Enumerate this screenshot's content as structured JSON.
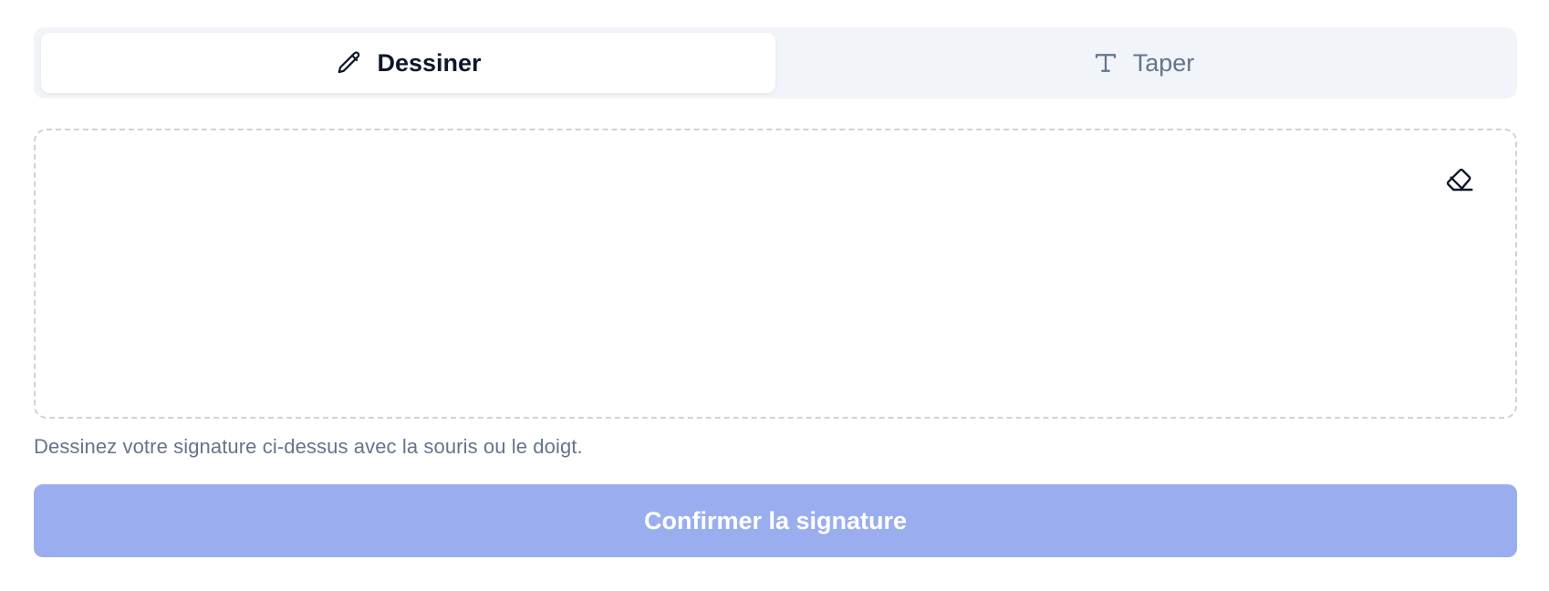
{
  "tabs": [
    {
      "label": "Dessiner",
      "icon": "pencil-icon",
      "active": true
    },
    {
      "label": "Taper",
      "icon": "type-icon",
      "active": false
    }
  ],
  "canvas": {
    "clear_icon": "eraser-icon"
  },
  "hint": "Dessinez votre signature ci-dessus avec la souris ou le doigt.",
  "confirm_button": {
    "label": "Confirmer la signature",
    "disabled": true
  },
  "colors": {
    "tabs_bg": "#f1f4f9",
    "active_text": "#0f172a",
    "muted_text": "#64748b",
    "dashed_border": "#cbd2dc",
    "button_disabled_bg": "#9aaeef"
  }
}
